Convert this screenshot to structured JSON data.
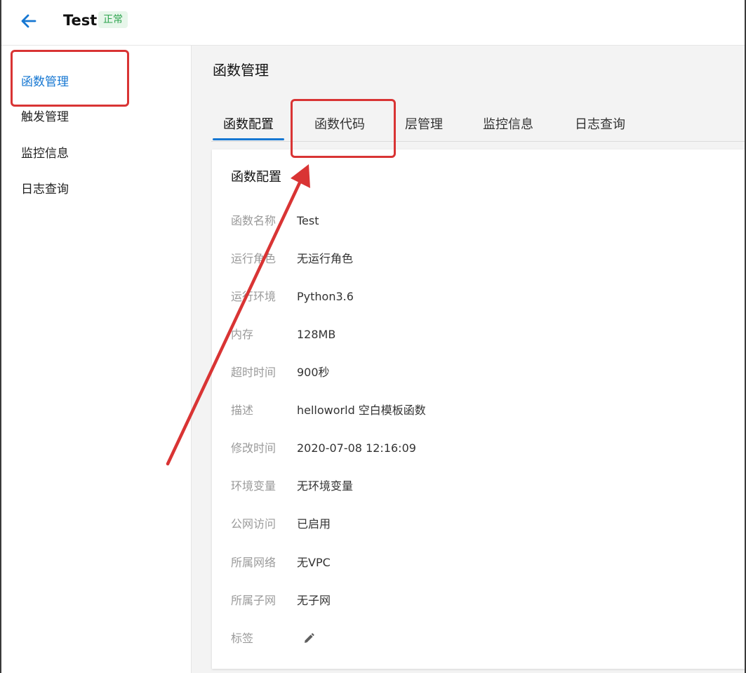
{
  "header": {
    "title": "Test",
    "status": "正常",
    "back_icon": "arrow-left-icon"
  },
  "sidebar": {
    "items": [
      {
        "label": "函数管理",
        "active": true
      },
      {
        "label": "触发管理",
        "active": false
      },
      {
        "label": "监控信息",
        "active": false
      },
      {
        "label": "日志查询",
        "active": false
      }
    ]
  },
  "main": {
    "title": "函数管理",
    "tabs": [
      {
        "label": "函数配置",
        "active": true
      },
      {
        "label": "函数代码",
        "active": false
      },
      {
        "label": "层管理",
        "active": false
      },
      {
        "label": "监控信息",
        "active": false
      },
      {
        "label": "日志查询",
        "active": false
      }
    ],
    "card": {
      "title": "函数配置",
      "fields": [
        {
          "label": "函数名称",
          "value": "Test"
        },
        {
          "label": "运行角色",
          "value": "无运行角色"
        },
        {
          "label": "运行环境",
          "value": "Python3.6"
        },
        {
          "label": "内存",
          "value": "128MB"
        },
        {
          "label": "超时时间",
          "value": "900秒"
        },
        {
          "label": "描述",
          "value": "helloworld 空白模板函数"
        },
        {
          "label": "修改时间",
          "value": "2020-07-08 12:16:09"
        },
        {
          "label": "环境变量",
          "value": "无环境变量"
        },
        {
          "label": "公网访问",
          "value": "已启用"
        },
        {
          "label": "所属网络",
          "value": "无VPC"
        },
        {
          "label": "所属子网",
          "value": "无子网"
        },
        {
          "label": "标签",
          "value": ""
        }
      ],
      "tag_edit_icon": "pencil-icon"
    }
  },
  "colors": {
    "accent": "#1677d2",
    "status_green": "#2ea44f",
    "annotation_red": "#d93434"
  }
}
